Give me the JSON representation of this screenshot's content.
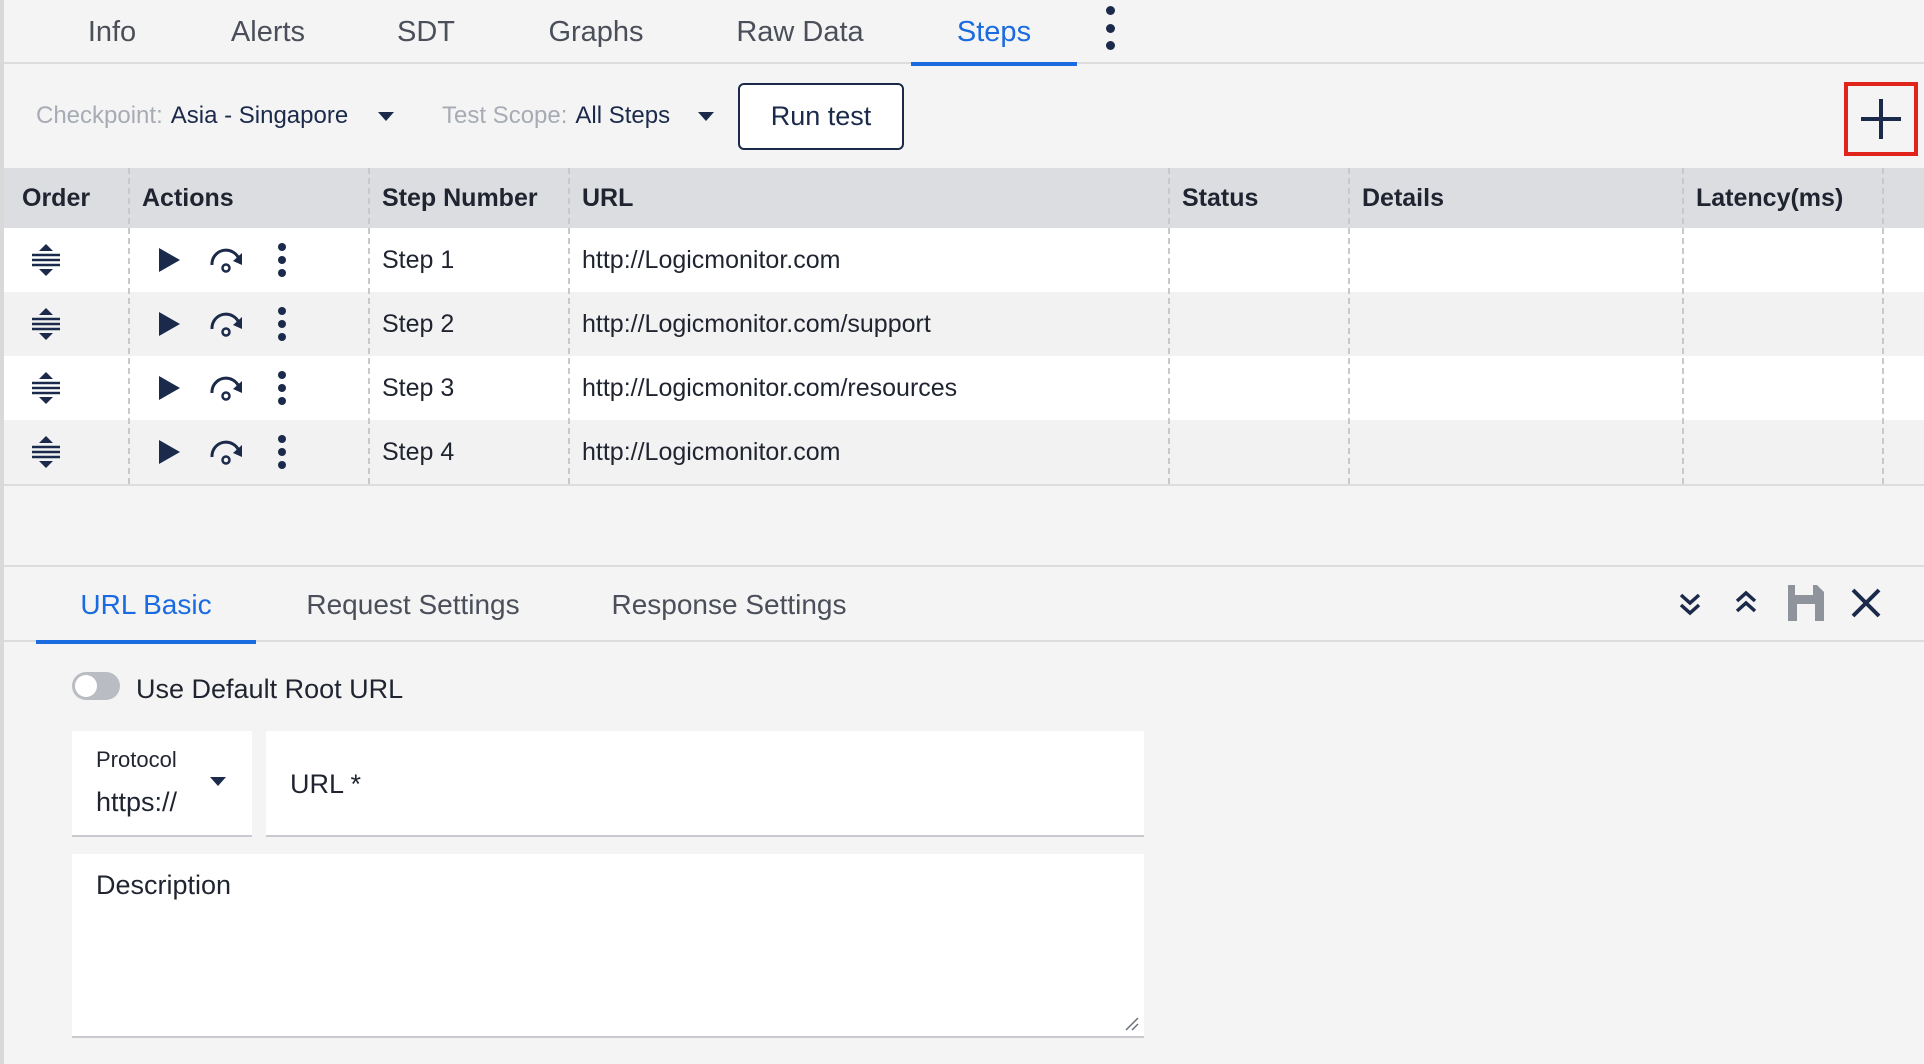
{
  "tabs": [
    {
      "label": "Info",
      "active": false
    },
    {
      "label": "Alerts",
      "active": false
    },
    {
      "label": "SDT",
      "active": false
    },
    {
      "label": "Graphs",
      "active": false
    },
    {
      "label": "Raw Data",
      "active": false
    },
    {
      "label": "Steps",
      "active": true
    }
  ],
  "toolbar": {
    "checkpoint_label": "Checkpoint:",
    "checkpoint_value": "Asia - Singapore",
    "scope_label": "Test Scope:",
    "scope_value": "All Steps",
    "run_test_label": "Run test",
    "add_icon": "plus-icon",
    "highlight_color": "#e0241b"
  },
  "grid": {
    "columns": [
      "Order",
      "Actions",
      "Step Number",
      "URL",
      "Status",
      "Details",
      "Latency(ms)"
    ],
    "rows": [
      {
        "step": "Step 1",
        "url": "http://Logicmonitor.com",
        "status": "",
        "details": "",
        "latency": ""
      },
      {
        "step": "Step 2",
        "url": "http://Logicmonitor.com/support",
        "status": "",
        "details": "",
        "latency": ""
      },
      {
        "step": "Step 3",
        "url": "http://Logicmonitor.com/resources",
        "status": "",
        "details": "",
        "latency": ""
      },
      {
        "step": "Step 4",
        "url": "http://Logicmonitor.com",
        "status": "",
        "details": "",
        "latency": ""
      }
    ],
    "selected_row_index": 1,
    "row_icons": [
      "reorder-icon",
      "play-icon",
      "redo-icon",
      "more-vertical-icon"
    ]
  },
  "panel": {
    "tabs": [
      {
        "label": "URL Basic",
        "active": true
      },
      {
        "label": "Request Settings",
        "active": false
      },
      {
        "label": "Response Settings",
        "active": false
      }
    ],
    "actions": [
      "expand-all-icon",
      "collapse-all-icon",
      "save-icon",
      "close-icon"
    ],
    "use_default_root_url_label": "Use Default Root URL",
    "use_default_root_url_on": false,
    "protocol_label": "Protocol",
    "protocol_value": "https://",
    "url_placeholder": "URL *",
    "description_placeholder": "Description"
  },
  "colors": {
    "accent": "#1a6be0",
    "navy": "#1b2a4a",
    "header_bg": "#dcdde0"
  }
}
